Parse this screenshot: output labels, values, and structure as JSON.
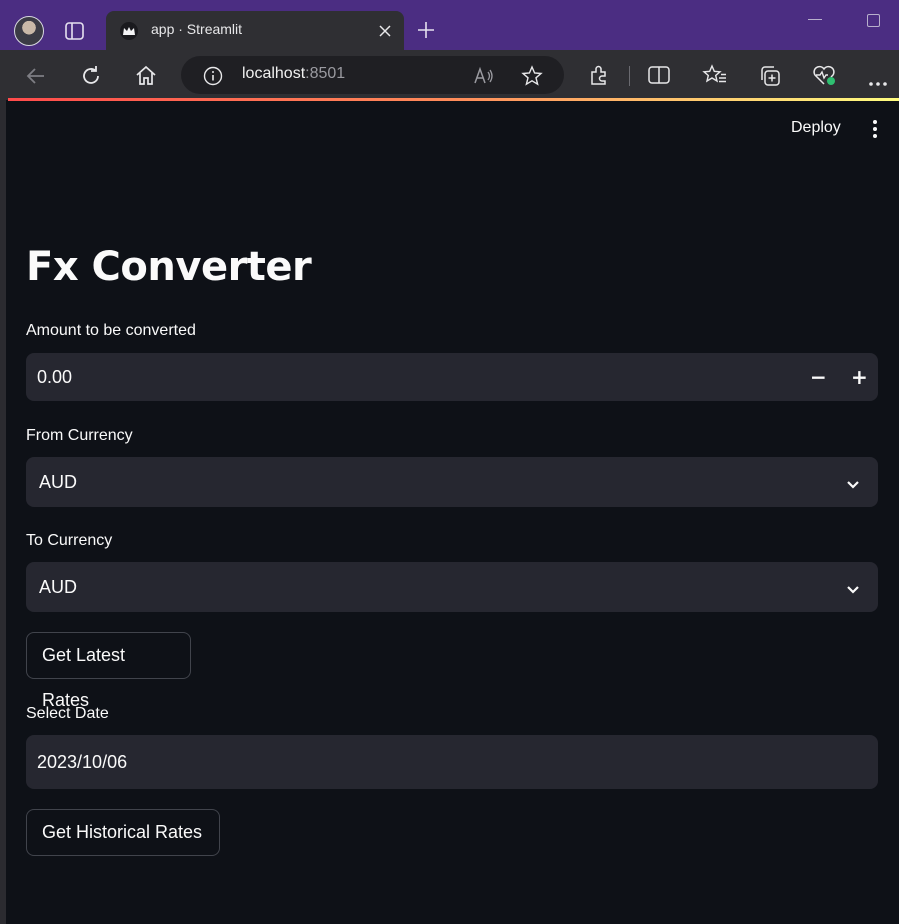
{
  "browser": {
    "tab_title": "app · Streamlit",
    "url_host": "localhost",
    "url_port": ":8501",
    "icons": [
      "profile-avatar",
      "tab-actions-icon",
      "streamlit-crown-icon",
      "close-icon",
      "plus-icon",
      "back-icon",
      "refresh-icon",
      "home-icon",
      "info-icon",
      "read-aloud-icon",
      "favorite-star-icon",
      "extensions-icon",
      "split-screen-icon",
      "favorites-icon",
      "collections-icon",
      "browser-essentials-icon",
      "more-icon"
    ]
  },
  "app": {
    "deploy_label": "Deploy",
    "title": "Fx Converter",
    "amount": {
      "label": "Amount to be converted",
      "value": "0.00",
      "minus": "−",
      "plus": "+"
    },
    "from_currency": {
      "label": "From Currency",
      "value": "AUD"
    },
    "to_currency": {
      "label": "To Currency",
      "value": "AUD"
    },
    "latest_button": "Get Latest Rates",
    "date": {
      "label": "Select Date",
      "value": "2023/10/06"
    },
    "historical_button": "Get Historical Rates"
  },
  "colors": {
    "background": "#0e1117",
    "input_bg": "#262730",
    "text": "#fafafa",
    "tabbar": "#4b2d82",
    "accent": "#ff4b4b"
  }
}
